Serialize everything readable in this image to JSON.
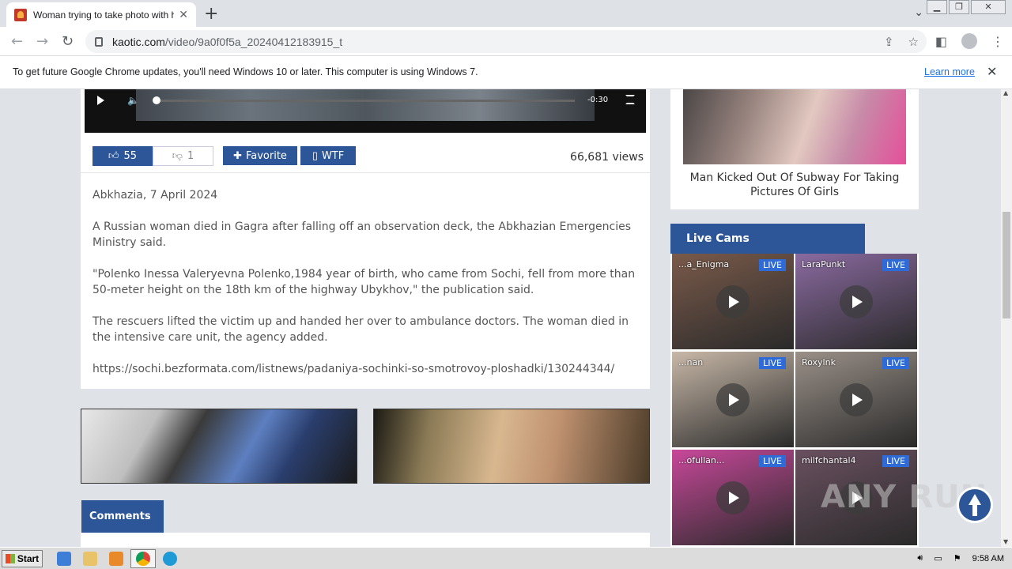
{
  "browser": {
    "tab_title": "Woman trying to take photo with he",
    "tab_close": "✕",
    "new_tab": "+",
    "url_domain": "kaotic.com",
    "url_path": "/video/9a0f0f5a_20240412183915_t",
    "infobar_message": "To get future Google Chrome updates, you'll need Windows 10 or later. This computer is using Windows 7.",
    "infobar_link": "Learn more",
    "infobar_close": "✕"
  },
  "video": {
    "time": "-0:30"
  },
  "actions": {
    "likes": "55",
    "dislikes": "1",
    "favorite_label": "Favorite",
    "wtf_label": "WTF",
    "views": "66,681 views"
  },
  "article": {
    "paragraphs": [
      "Abkhazia, 7 April 2024",
      "A Russian woman died in Gagra after falling off an observation deck, the Abkhazian Emergencies Ministry said.",
      "\"Polenko Inessa Valeryevna Polenko,1984 year of birth, who came from Sochi, fell from more than 50-meter height on the 18th km of the highway Ubykhov,\" the publication said.",
      "The rescuers lifted the victim up and handed her over to ambulance doctors. The woman died in the intensive care unit, the agency added.",
      "https://sochi.bezformata.com/listnews/padaniya-sochinki-so-smotrovoy-ploshadki/130244344/"
    ]
  },
  "comments": {
    "title": "Comments"
  },
  "sidebar": {
    "related_caption": "Man Kicked Out Of Subway For Taking Pictures Of Girls",
    "cams_title": "Live Cams",
    "live_label": "LIVE",
    "cams": [
      {
        "name": "...a_Enigma",
        "bg": "#7a5a4a"
      },
      {
        "name": "LaraPunkt",
        "bg": "#8a6aa0"
      },
      {
        "name": "...nan",
        "bg": "#c8b8a8"
      },
      {
        "name": "Roxylnk",
        "bg": "#9a9088"
      },
      {
        "name": "...ofullan...",
        "bg": "#c8489a"
      },
      {
        "name": "milfchantal4",
        "bg": "#6a5060"
      }
    ]
  },
  "watermark": "ANY RUN",
  "taskbar": {
    "start_label": "Start",
    "clock": "9:58 AM"
  },
  "colors": {
    "brand_blue": "#2c5697",
    "live_blue": "#2f6bd6"
  }
}
